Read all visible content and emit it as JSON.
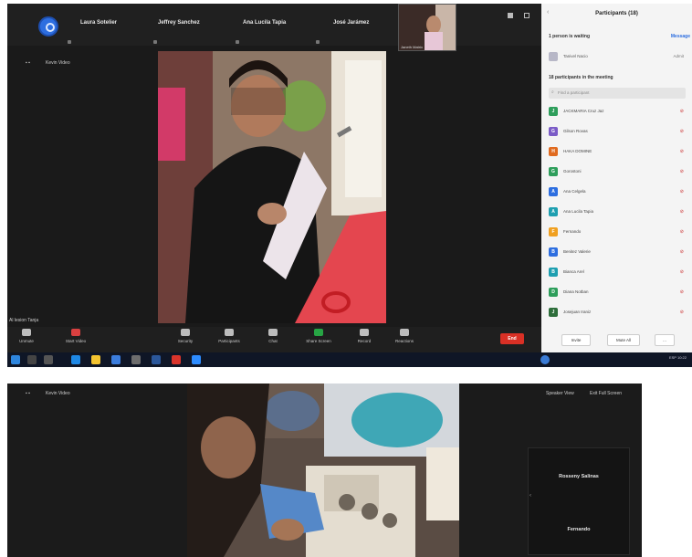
{
  "shot1": {
    "top_names": [
      "Laura Sotelier",
      "Jeffrey Sanchez",
      "Ana Lucila Tapia",
      "José Jarámez"
    ],
    "thumb_label": "Janeth Matrix",
    "left_view_label": "Kevin Video",
    "speaker_label": "Al lesion Tanja",
    "toolbar": [
      {
        "label": "Unmute"
      },
      {
        "label": "Start Video"
      },
      {
        "label": "Security"
      },
      {
        "label": "Participants"
      },
      {
        "label": "Chat"
      },
      {
        "label": "Share Screen"
      },
      {
        "label": "Record"
      },
      {
        "label": "Reactions"
      }
    ],
    "end_label": "End",
    "participants_panel": {
      "title": "Participants (18)",
      "waiting_title": "1 person is waiting",
      "message_link": "Message",
      "waiting_person": "Tanivel Nacio",
      "admit_label": "Admit",
      "in_meeting_title": "18 participants in the meeting",
      "search_placeholder": "Find a participant",
      "participants": [
        {
          "name": "JACKMARIA Cruz Jaz",
          "initial": "J",
          "color": "#2e9e5b"
        },
        {
          "name": "Gilson Rovas",
          "initial": "G",
          "color": "#7b5cc7"
        },
        {
          "name": "HAKA DOMINE",
          "initial": "H",
          "color": "#e06a1f"
        },
        {
          "name": "Gorostoni",
          "initial": "G",
          "color": "#2e9e5b"
        },
        {
          "name": "Ana Celgela",
          "initial": "A",
          "color": "#2d6ee0"
        },
        {
          "name": "Ana Lucila Tapia",
          "initial": "A",
          "color": "#1e9fb0"
        },
        {
          "name": "Fernando",
          "initial": "F",
          "color": "#f0a020"
        },
        {
          "name": "Benitez Valerie",
          "initial": "B",
          "color": "#2d6ee0"
        },
        {
          "name": "Bianca Arel",
          "initial": "B",
          "color": "#1e9fb0"
        },
        {
          "name": "Diana Notban",
          "initial": "D",
          "color": "#2e9e5b"
        },
        {
          "name": "Josejuan Iraniz",
          "initial": "J",
          "color": "#2e6e3b"
        }
      ],
      "footer": {
        "invite": "Invite",
        "mute_all": "Mute All",
        "more": "..."
      }
    },
    "taskbar": {
      "tray_text": "ESP 10:22"
    }
  },
  "shot2": {
    "left_view_label": "Kevin Video",
    "top_right": [
      "Speaker View",
      "Exit Full Screen"
    ],
    "tile_names": [
      "Rosseny Salinas",
      "Fernando"
    ]
  }
}
